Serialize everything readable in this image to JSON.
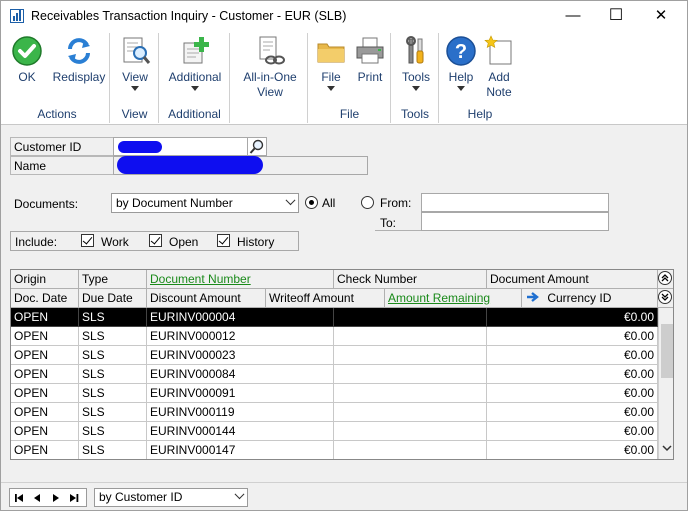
{
  "window": {
    "title": "Receivables Transaction Inquiry - Customer  -  EUR (SLB)",
    "minimize": "—",
    "maximize": "☐",
    "close": "✕"
  },
  "ribbon": {
    "groups": [
      {
        "label": "Actions",
        "buttons": [
          {
            "label": "OK",
            "icon": "ok-check-icon"
          },
          {
            "label": "Redisplay",
            "icon": "redisplay-arrows-icon"
          }
        ]
      },
      {
        "label": "View",
        "buttons": [
          {
            "label": "View",
            "icon": "view-magnifier-icon"
          }
        ]
      },
      {
        "label": "Additional",
        "buttons": [
          {
            "label": "Additional",
            "icon": "additional-plus-icon"
          }
        ]
      },
      {
        "label": "",
        "buttons": [
          {
            "label": "All-in-One View",
            "line1": "All-in-One",
            "line2": "View",
            "icon": "document-chain-icon"
          }
        ]
      },
      {
        "label": "File",
        "buttons": [
          {
            "label": "File",
            "icon": "folder-icon"
          },
          {
            "label": "Print",
            "icon": "printer-icon"
          }
        ]
      },
      {
        "label": "Tools",
        "buttons": [
          {
            "label": "Tools",
            "icon": "tools-icon"
          }
        ]
      },
      {
        "label": "Help",
        "buttons": [
          {
            "label": "Help",
            "icon": "help-question-icon"
          },
          {
            "label": "Add Note",
            "line1": "Add",
            "line2": "Note",
            "icon": "note-star-icon"
          }
        ]
      }
    ]
  },
  "form": {
    "customer_id_label": "Customer ID",
    "name_label": "Name",
    "documents_label": "Documents:",
    "documents_value": "by Document Number",
    "all_label": "All",
    "from_label": "From:",
    "to_label": "To:",
    "include_label": "Include:",
    "work_label": "Work",
    "open_label": "Open",
    "history_label": "History"
  },
  "grid": {
    "header_row1": [
      "Origin",
      "Type",
      "Document Number",
      "Check Number",
      "Document Amount"
    ],
    "header_row2": [
      "Doc. Date",
      "Due Date",
      "Discount Amount",
      "Writeoff Amount",
      "Amount Remaining",
      "Currency ID"
    ],
    "rows": [
      {
        "origin": "OPEN",
        "type": "SLS",
        "doc": "EURINV000004",
        "amount": "€0.00"
      },
      {
        "origin": "OPEN",
        "type": "SLS",
        "doc": "EURINV000012",
        "amount": "€0.00"
      },
      {
        "origin": "OPEN",
        "type": "SLS",
        "doc": "EURINV000023",
        "amount": "€0.00"
      },
      {
        "origin": "OPEN",
        "type": "SLS",
        "doc": "EURINV000084",
        "amount": "€0.00"
      },
      {
        "origin": "OPEN",
        "type": "SLS",
        "doc": "EURINV000091",
        "amount": "€0.00"
      },
      {
        "origin": "OPEN",
        "type": "SLS",
        "doc": "EURINV000119",
        "amount": "€0.00"
      },
      {
        "origin": "OPEN",
        "type": "SLS",
        "doc": "EURINV000144",
        "amount": "€0.00"
      },
      {
        "origin": "OPEN",
        "type": "SLS",
        "doc": "EURINV000147",
        "amount": "€0.00"
      }
    ]
  },
  "footer": {
    "sort_value": "by Customer ID"
  },
  "colors": {
    "ribbon_text": "#1f3f6e",
    "link_green": "#1a8a1a",
    "redaction_blue": "#0e0ef0",
    "selected_row": "#000000"
  }
}
